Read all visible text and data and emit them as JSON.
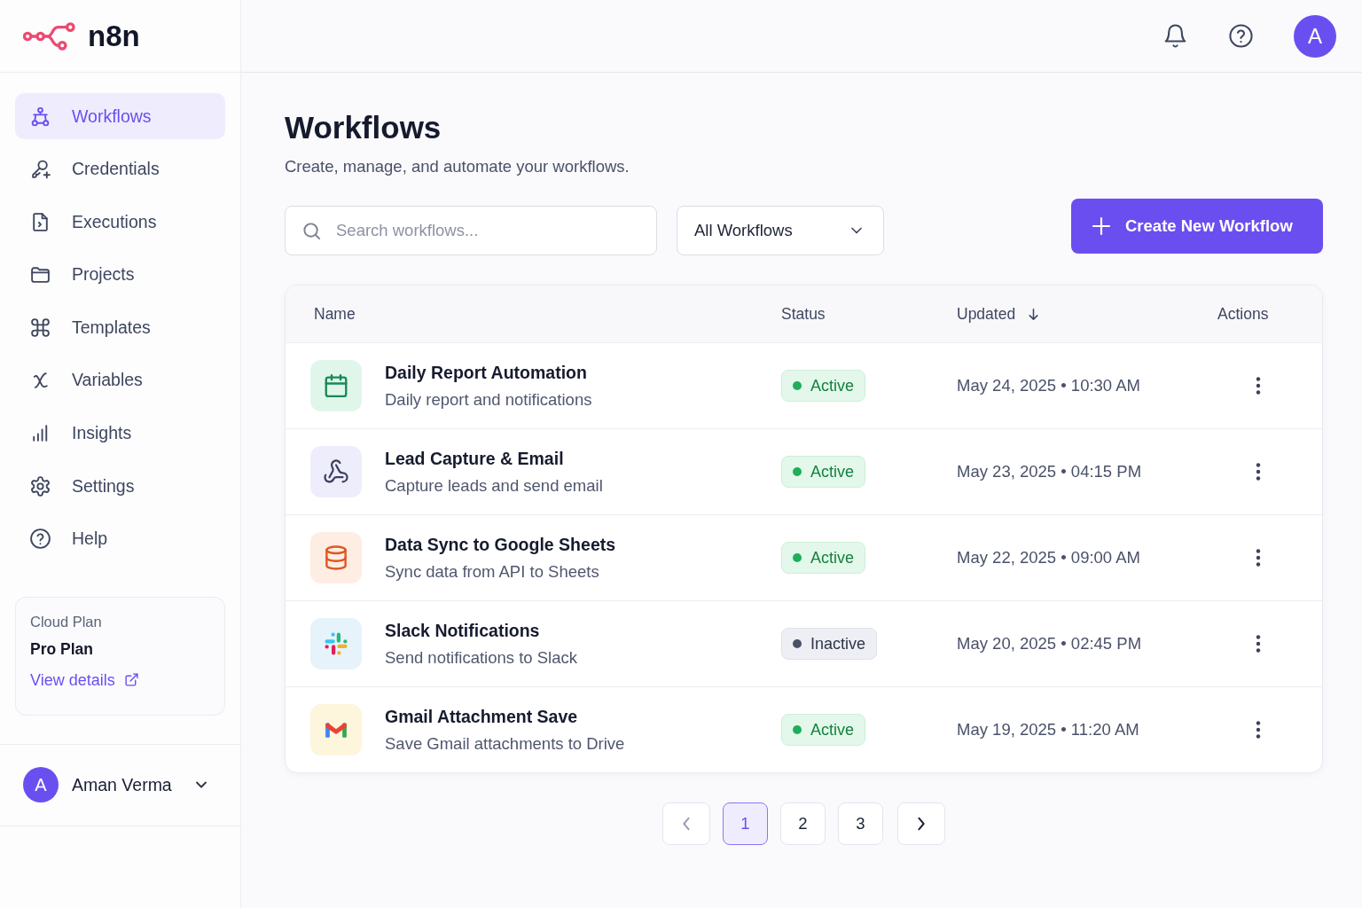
{
  "logo": {
    "text": "n8n"
  },
  "sidebar": {
    "items": [
      {
        "label": "Workflows",
        "selected": true
      },
      {
        "label": "Credentials",
        "selected": false
      },
      {
        "label": "Executions",
        "selected": false
      },
      {
        "label": "Projects",
        "selected": false
      },
      {
        "label": "Templates",
        "selected": false
      },
      {
        "label": "Variables",
        "selected": false
      },
      {
        "label": "Insights",
        "selected": false
      },
      {
        "label": "Settings",
        "selected": false
      },
      {
        "label": "Help",
        "selected": false
      }
    ],
    "plan_card": {
      "label": "Cloud Plan",
      "plan": "Pro Plan",
      "link": "View details"
    },
    "user": {
      "avatar_letter": "A",
      "name": "Aman Verma"
    }
  },
  "top_bar": {
    "avatar_letter": "A"
  },
  "page": {
    "title": "Workflows",
    "subtitle": "Create, manage, and automate your workflows."
  },
  "toolbar": {
    "search": {
      "placeholder": "Search workflows..."
    },
    "filter": {
      "value": "All Workflows"
    },
    "create_button": {
      "label": "Create New Workflow"
    }
  },
  "table": {
    "columns": [
      {
        "label": "Name",
        "sorted": false
      },
      {
        "label": "Status",
        "sorted": false
      },
      {
        "label": "Updated",
        "sorted": true
      },
      {
        "label": "Actions",
        "sorted": false
      }
    ],
    "rows": [
      {
        "name": "Daily Report Automation",
        "description": "Daily report and notifications",
        "active": true,
        "status": "Active",
        "updated": "May 24, 2025 • 10:30 AM"
      },
      {
        "name": "Lead Capture & Email",
        "description": "Capture leads and send email",
        "active": true,
        "status": "Active",
        "updated": "May 23, 2025 • 04:15 PM"
      },
      {
        "name": "Data Sync to Google Sheets",
        "description": "Sync data from API to Sheets",
        "active": true,
        "status": "Active",
        "updated": "May 22, 2025 • 09:00 AM"
      },
      {
        "name": "Slack Notifications",
        "description": "Send notifications to Slack",
        "active": false,
        "status": "Inactive",
        "updated": "May 20, 2025 • 02:45 PM"
      },
      {
        "name": "Gmail Attachment Save",
        "description": "Save Gmail attachments to Drive",
        "active": true,
        "status": "Active",
        "updated": "May 19, 2025 • 11:20 AM"
      }
    ]
  },
  "pagination": {
    "previous": {
      "disabled": true
    },
    "pages": [
      {
        "label": "1",
        "selected": true
      },
      {
        "label": "2",
        "selected": false
      },
      {
        "label": "3",
        "selected": false
      }
    ],
    "next": {
      "disabled": false
    }
  }
}
